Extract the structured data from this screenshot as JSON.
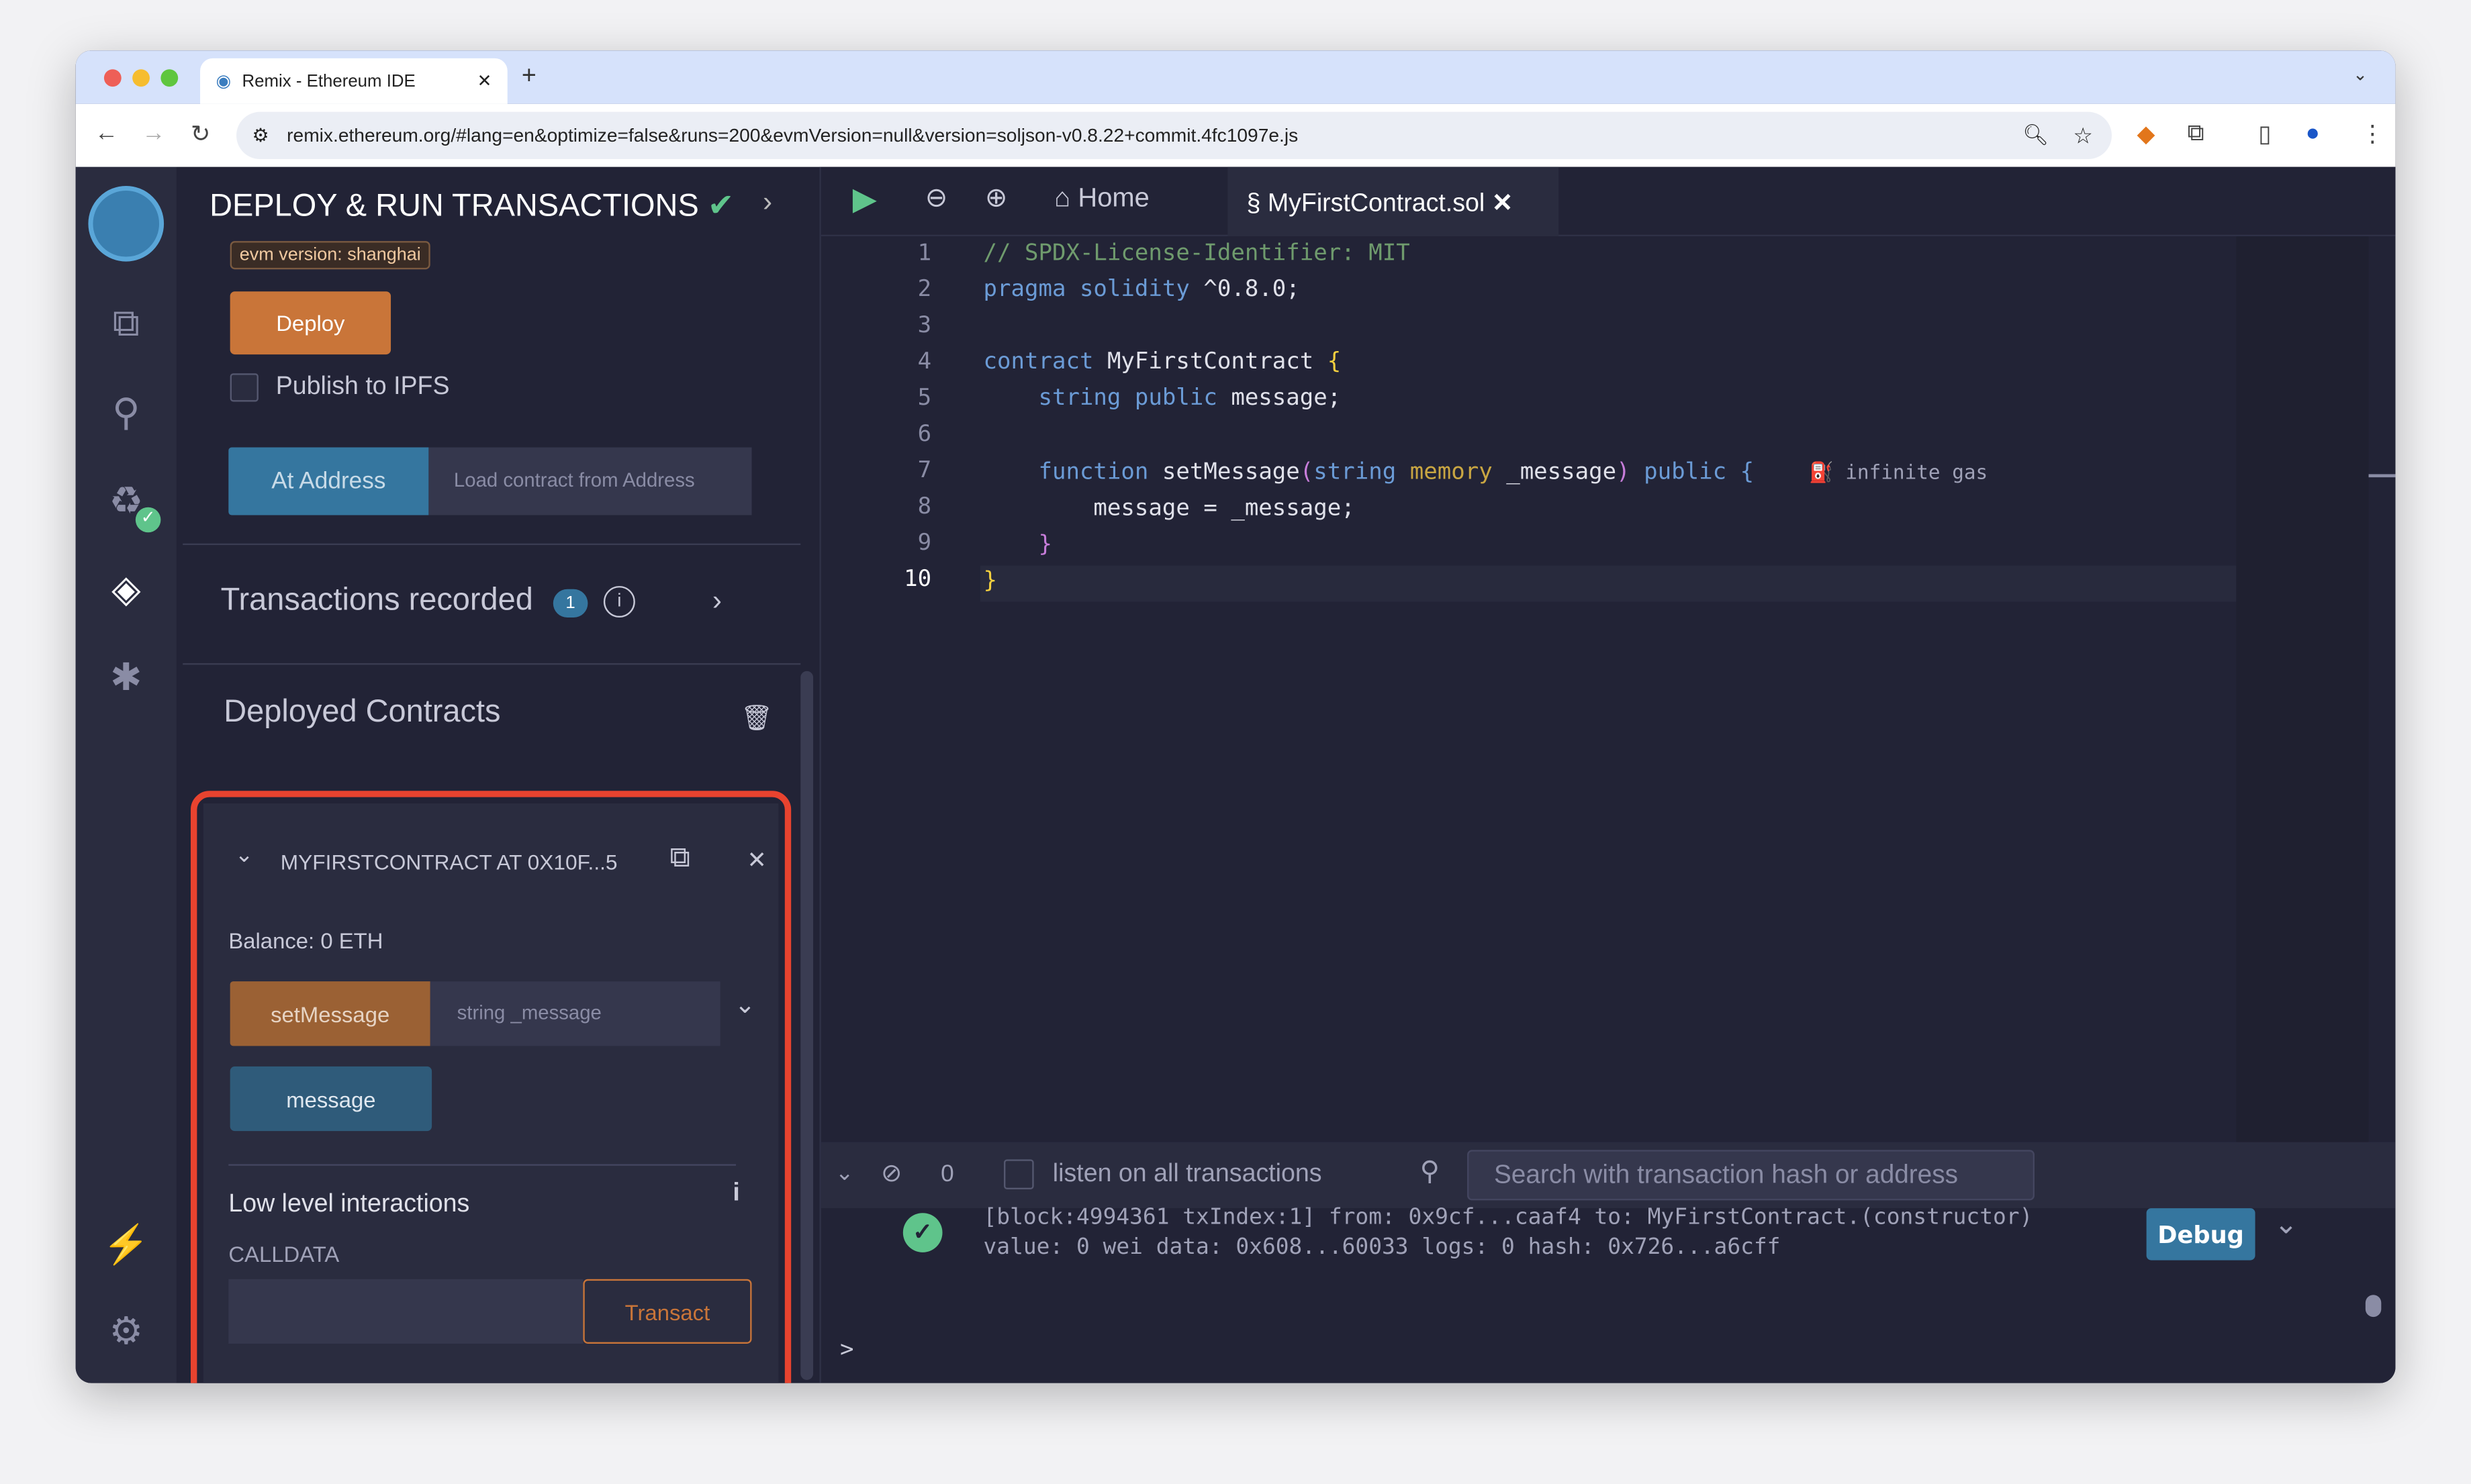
{
  "browser": {
    "tab_title": "Remix - Ethereum IDE",
    "url": "remix.ethereum.org/#lang=en&optimize=false&runs=200&evmVersion=null&version=soljson-v0.8.22+commit.4fc1097e.js"
  },
  "panel": {
    "title": "DEPLOY & RUN TRANSACTIONS",
    "evm_badge": "evm version: shanghai",
    "deploy": "Deploy",
    "publish_ipfs": "Publish to IPFS",
    "at_address": "At Address",
    "load_placeholder": "Load contract from Address",
    "tx_recorded": "Transactions recorded",
    "tx_count": "1",
    "deployed_title": "Deployed Contracts"
  },
  "contract": {
    "name": "MYFIRSTCONTRACT AT 0X10F...5",
    "balance": "Balance: 0 ETH",
    "set_message": "setMessage",
    "set_message_placeholder": "string _message",
    "message": "message",
    "low_level": "Low level interactions",
    "calldata": "CALLDATA",
    "transact": "Transact"
  },
  "editor": {
    "tab_home": "Home",
    "tab_file": "MyFirstContract.sol",
    "gas_hint": "infinite gas",
    "lines": [
      "// SPDX-License-Identifier: MIT",
      "pragma solidity ^0.8.0;",
      "",
      "contract MyFirstContract {",
      "    string public message;",
      "",
      "    function setMessage(string memory _message) public {",
      "        message = _message;",
      "    }",
      "}"
    ]
  },
  "terminal": {
    "count": "0",
    "listen": "listen on all transactions",
    "search_placeholder": "Search with transaction hash or address",
    "log1": "[block:4994361 txIndex:1] from: 0x9cf...caaf4 to: MyFirstContract.(constructor)",
    "log2": "value: 0 wei data: 0x608...60033 logs: 0 hash: 0x726...a6cff",
    "debug": "Debug",
    "prompt": ">"
  },
  "colors": {
    "accent": "#c97539",
    "blue": "#35769f",
    "highlight": "#e8432f",
    "success": "#5fc48b"
  }
}
